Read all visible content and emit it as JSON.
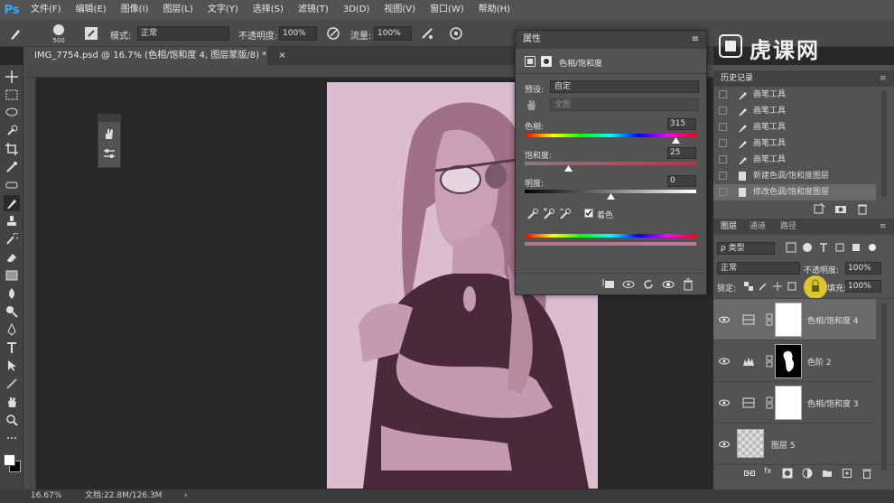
{
  "app": {
    "logo": "Ps"
  },
  "menu": [
    "文件(F)",
    "编辑(E)",
    "图像(I)",
    "图层(L)",
    "文字(Y)",
    "选择(S)",
    "滤镜(T)",
    "3D(D)",
    "视图(V)",
    "窗口(W)",
    "帮助(H)"
  ],
  "options": {
    "brush_size": "500",
    "mode_label": "模式:",
    "mode_value": "正常",
    "opacity_label": "不透明度:",
    "opacity_value": "100%",
    "flow_label": "流量:",
    "flow_value": "100%"
  },
  "document": {
    "tab_title": "IMG_7754.psd @ 16.7% (色相/饱和度 4, 图层蒙版/8) *",
    "tab_close": "×"
  },
  "status": {
    "zoom": "16.67%",
    "doc_info": "文档:22.8M/126.3M"
  },
  "properties": {
    "panel_title": "属性",
    "adjustment_title": "色相/饱和度",
    "preset_label": "预设:",
    "preset_value": "自定",
    "channel_value": "全图",
    "hue_label": "色相:",
    "hue_value": "315",
    "hue_pos": 0.88,
    "saturation_label": "饱和度:",
    "saturation_value": "25",
    "saturation_pos": 0.25,
    "lightness_label": "明度:",
    "lightness_value": "0",
    "lightness_pos": 0.5,
    "colorize_label": "着色"
  },
  "history": {
    "tab_label": "历史记录",
    "items": [
      "画笔工具",
      "画笔工具",
      "画笔工具",
      "画笔工具",
      "画笔工具",
      "新建色调/饱和度图层",
      "修改色调/饱和度图层"
    ]
  },
  "layers": {
    "tabs": [
      "图层",
      "通道",
      "路径"
    ],
    "filter_label": "ρ 类型",
    "blend_mode": "正常",
    "opacity_label": "不透明度:",
    "opacity_value": "100%",
    "lock_label": "锁定:",
    "fill_label": "填充:",
    "fill_value": "100%",
    "items": [
      {
        "name": "色相/饱和度 4",
        "type": "hue-saturation"
      },
      {
        "name": "色阶 2",
        "type": "levels"
      },
      {
        "name": "色相/饱和度 3",
        "type": "hue-saturation"
      },
      {
        "name": "图层 5",
        "type": "pixel"
      }
    ]
  },
  "watermark": "虎课网",
  "colors": {
    "accent": "#31a8ff",
    "photo_tint": "#dcbdd0",
    "shirt": "#4a2a3a"
  }
}
